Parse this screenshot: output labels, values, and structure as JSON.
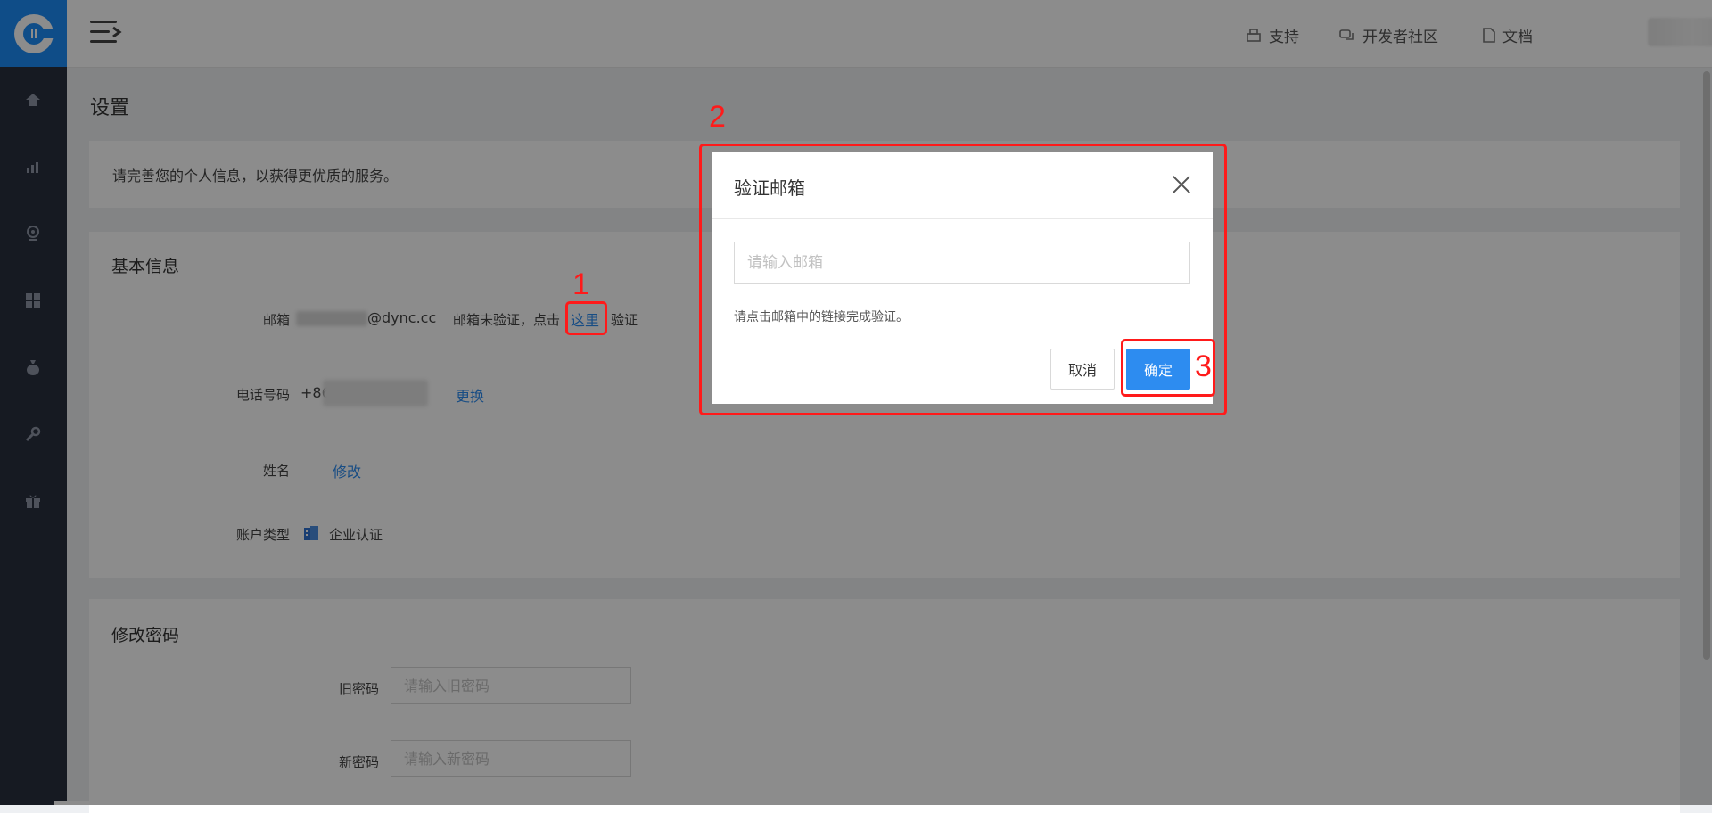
{
  "topnav": {
    "support": "支持",
    "community": "开发者社区",
    "docs": "文档"
  },
  "page": {
    "title": "设置",
    "notice": "请完善您的个人信息，以获得更优质的服务。"
  },
  "basic_info": {
    "title": "基本信息",
    "email_label": "邮箱",
    "email_value": "@dync.cc",
    "email_unverified": "邮箱未验证，点击",
    "email_here": "这里",
    "email_verify": "验证",
    "phone_label": "电话号码",
    "phone_prefix": "+86",
    "phone_change": "更换",
    "name_label": "姓名",
    "name_edit": "修改",
    "account_type_label": "账户类型",
    "account_type_value": "企业认证"
  },
  "password": {
    "title": "修改密码",
    "old_label": "旧密码",
    "old_placeholder": "请输入旧密码",
    "new_label": "新密码",
    "new_placeholder": "请输入新密码"
  },
  "modal": {
    "title": "验证邮箱",
    "email_placeholder": "请输入邮箱",
    "hint": "请点击邮箱中的链接完成验证。",
    "cancel": "取消",
    "confirm": "确定"
  },
  "annotations": {
    "one": "1",
    "two": "2",
    "three": "3"
  },
  "colors": {
    "sidebar": "#28303f",
    "brand": "#1d8cf8",
    "link": "#2d8cf0",
    "annotation": "#ff1a1a"
  },
  "icons": {
    "logo": "logo-icon",
    "menu": "menu-toggle-icon",
    "support": "printer-icon",
    "community": "chat-icon",
    "docs": "document-icon",
    "sidebar": [
      "home-icon",
      "bar-chart-icon",
      "webcam-icon",
      "grid-icon",
      "money-bag-icon",
      "wrench-icon",
      "gift-icon"
    ]
  }
}
